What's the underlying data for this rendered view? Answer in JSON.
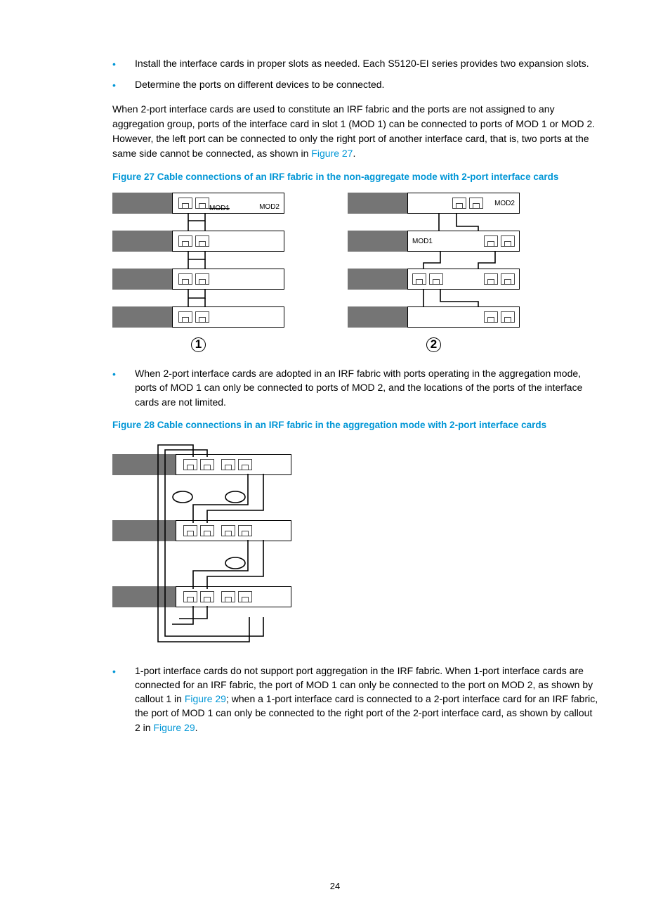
{
  "page_number": "24",
  "bullets_top": [
    "Install the interface cards in proper slots as needed. Each S5120-EI series provides two expansion slots.",
    "Determine the ports on different devices to be connected."
  ],
  "para1_pre": "When 2-port interface cards are used to constitute an IRF fabric and the ports are not assigned to any aggregation group, ports of the interface card in slot 1 (MOD 1) can be connected to ports of MOD 1 or MOD 2. However, the left port can be connected to only the right port of another interface card, that is, two ports at the same side cannot be connected, as shown in ",
  "para1_link": "Figure 27",
  "para1_post": ".",
  "fig27_caption": "Figure 27 Cable connections of an IRF fabric in the non-aggregate mode with 2-port interface cards",
  "fig27_labels": {
    "mod1_strike": "MOD1",
    "mod2_a": "MOD2",
    "mod1_b": "MOD1",
    "mod2_b": "MOD2",
    "circle1": "1",
    "circle2": "2"
  },
  "bullet_mid": "When 2-port interface cards are adopted in an IRF fabric with ports operating in the aggregation mode, ports of MOD 1 can only be connected to ports of MOD 2, and the locations of the ports of the interface cards are not limited.",
  "fig28_caption": "Figure 28 Cable connections in an IRF fabric in the aggregation mode with 2-port interface cards",
  "para_last_pre": "1-port interface cards do not support port aggregation in the IRF fabric. When 1-port interface cards are connected for an IRF fabric, the port of MOD 1 can only be connected to the port on MOD 2, as shown by callout 1 in ",
  "para_last_link1": "Figure 29",
  "para_last_mid": "; when a 1-port interface card is connected to a 2-port interface card for an IRF fabric, the port of MOD 1 can only be connected to the right port of the 2-port interface card, as shown by callout 2 in ",
  "para_last_link2": "Figure 29",
  "para_last_post": "."
}
